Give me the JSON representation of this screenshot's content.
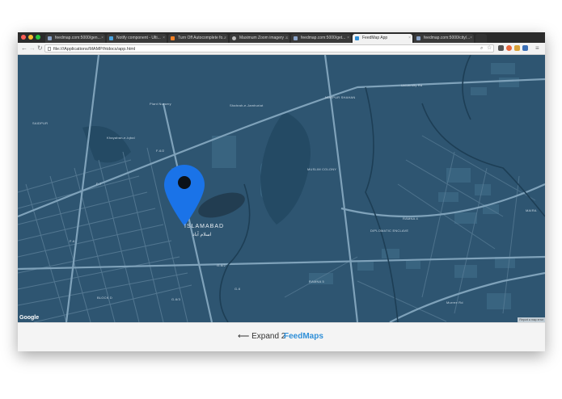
{
  "browser": {
    "tabs": [
      {
        "label": "feedmap.com:5000/gen...",
        "active": false
      },
      {
        "label": "Notify component - Ulti...",
        "active": false
      },
      {
        "label": "Turn Off Autocomplete fo...",
        "active": false
      },
      {
        "label": "Maximum Zoom imagery ...",
        "active": false
      },
      {
        "label": "feedmap.com:5000/get...",
        "active": false
      },
      {
        "label": "FeedMap App",
        "active": true
      },
      {
        "label": "feedmap.com:5000/city/...",
        "active": false
      }
    ],
    "tab_close": "×",
    "url": "file:///Applications/MAMP/htdocs/app.html",
    "nav": {
      "back": "←",
      "forward": "→",
      "reload": "↻"
    },
    "star_glyph": "☆",
    "menu_glyph": "≡"
  },
  "map": {
    "city_label": "ISLAMABAD",
    "city_label_urdu": "اسلام آباد",
    "area_labels": [
      {
        "text": "SAIDPUR",
        "kind": "area"
      },
      {
        "text": "F-7",
        "kind": "sector"
      },
      {
        "text": "F-6/2",
        "kind": "sector"
      },
      {
        "text": "F-6",
        "kind": "sector"
      },
      {
        "text": "NURPUR SHAHAN",
        "kind": "area"
      },
      {
        "text": "MUSLIM COLONY",
        "kind": "area"
      },
      {
        "text": "DIPLOMATIC ENCLAVE",
        "kind": "area"
      },
      {
        "text": "RAMNA 4",
        "kind": "area"
      },
      {
        "text": "RAMNA 5",
        "kind": "area"
      },
      {
        "text": "MAIRA",
        "kind": "area"
      },
      {
        "text": "BLOCK D",
        "kind": "area"
      },
      {
        "text": "G-6/2",
        "kind": "sector"
      },
      {
        "text": "G-6",
        "kind": "sector"
      },
      {
        "text": "G-6/3",
        "kind": "sector"
      },
      {
        "text": "Plant Nursery",
        "kind": "poi"
      },
      {
        "text": "University Rd",
        "kind": "road"
      },
      {
        "text": "Murree Rd",
        "kind": "road"
      },
      {
        "text": "Khayaban-e-Iqbal",
        "kind": "road"
      },
      {
        "text": "Shahrah-e-Jamhuriat",
        "kind": "road"
      }
    ],
    "pin_color": "#1a73e8",
    "map_color": "#2e5571",
    "google_logo": "Google",
    "attribution": "Report a map error"
  },
  "footer": {
    "expand_label": "⟵ Expand 2",
    "brand": "FeedMaps",
    "brand_color": "#2f8fd8"
  }
}
